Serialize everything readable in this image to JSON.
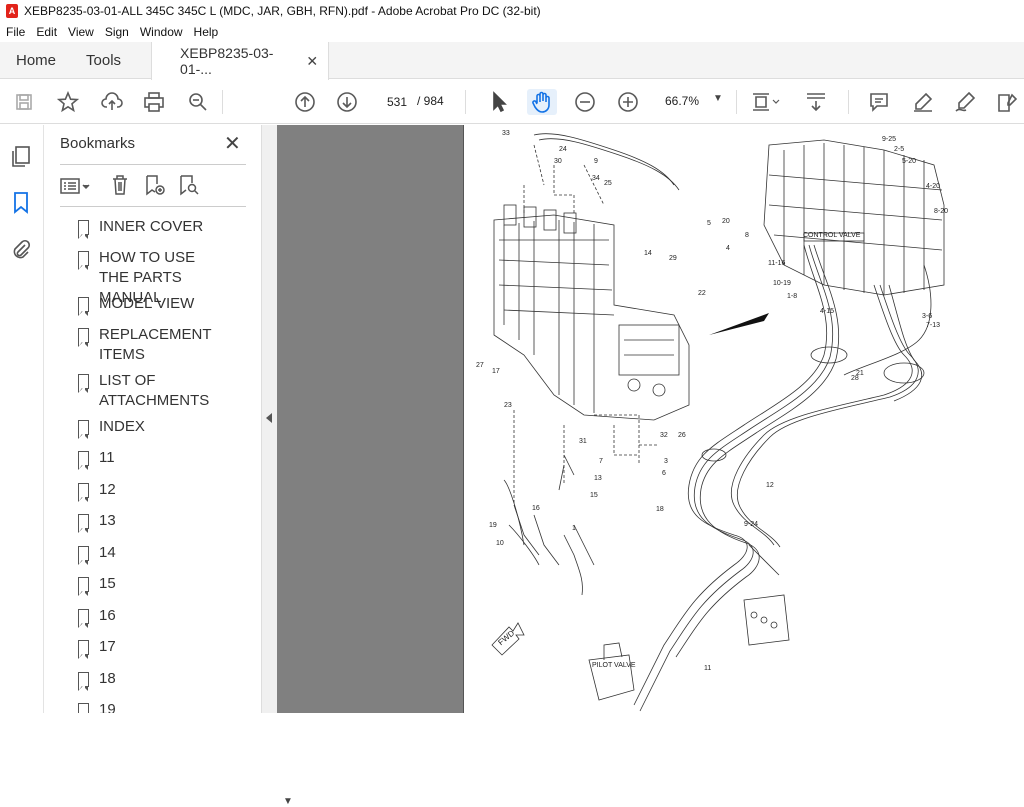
{
  "window": {
    "title": "XEBP8235-03-01-ALL 345C 345C L (MDC, JAR, GBH, RFN).pdf - Adobe Acrobat Pro DC (32-bit)"
  },
  "menu": [
    "File",
    "Edit",
    "View",
    "Sign",
    "Window",
    "Help"
  ],
  "tabs": {
    "home": "Home",
    "tools": "Tools",
    "doc": "XEBP8235-03-01-..."
  },
  "toolbar": {
    "page_current": "531",
    "page_total": "/ 984",
    "zoom": "66.7%"
  },
  "bookmarks_panel": {
    "title": "Bookmarks",
    "items": [
      "INNER COVER",
      "HOW TO USE THE PARTS MANUAL",
      "MODEL VIEW",
      "REPLACEMENT ITEMS",
      "LIST OF ATTACHMENTS",
      "INDEX",
      "11",
      "12",
      "13",
      "14",
      "15",
      "16",
      "17",
      "18",
      "19"
    ]
  },
  "drawing": {
    "labels": [
      "CONTROL VALVE",
      "PILOT VALVE",
      "FWD"
    ],
    "part_numbers": [
      "33",
      "24",
      "30",
      "9",
      "25",
      "34",
      "7",
      "32",
      "29",
      "14",
      "5",
      "20",
      "4",
      "8",
      "22",
      "23",
      "17",
      "27",
      "31",
      "13",
      "3",
      "6",
      "1",
      "16",
      "19",
      "10",
      "15",
      "11",
      "26",
      "18",
      "12",
      "21",
      "28",
      "2-5",
      "5-20",
      "9-25",
      "4-20",
      "8-20",
      "11-16",
      "10-19",
      "1-8",
      "4-15",
      "3-6",
      "7-13",
      "9-24"
    ]
  }
}
